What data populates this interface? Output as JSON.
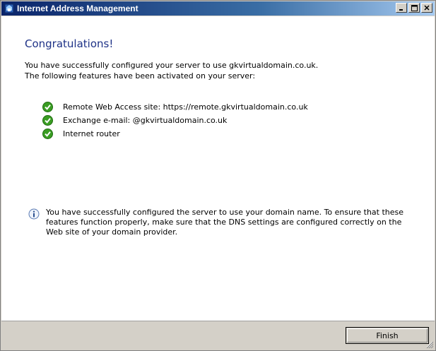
{
  "window": {
    "title": "Internet Address Management",
    "minimize_label": "_",
    "maximize_label": "□",
    "close_label": "×"
  },
  "main": {
    "heading": "Congratulations!",
    "intro_line1": "You have successfully configured your server to use gkvirtualdomain.co.uk.",
    "intro_line2": "The following features have been activated on your server:",
    "features": [
      {
        "label": "Remote Web Access site: https://remote.gkvirtualdomain.co.uk",
        "icon": "green-check-icon"
      },
      {
        "label": "Exchange e-mail: @gkvirtualdomain.co.uk",
        "icon": "green-check-icon"
      },
      {
        "label": "Internet router",
        "icon": "green-check-icon"
      }
    ],
    "info_text": "You have successfully configured the server to use your domain name. To ensure that these features function properly, make sure that the DNS settings are configured correctly on the Web site of your domain provider."
  },
  "footer": {
    "finish_label": "Finish"
  },
  "colors": {
    "heading": "#1e3287",
    "check": "#3a9d23",
    "titlebar_start": "#0a246a"
  }
}
